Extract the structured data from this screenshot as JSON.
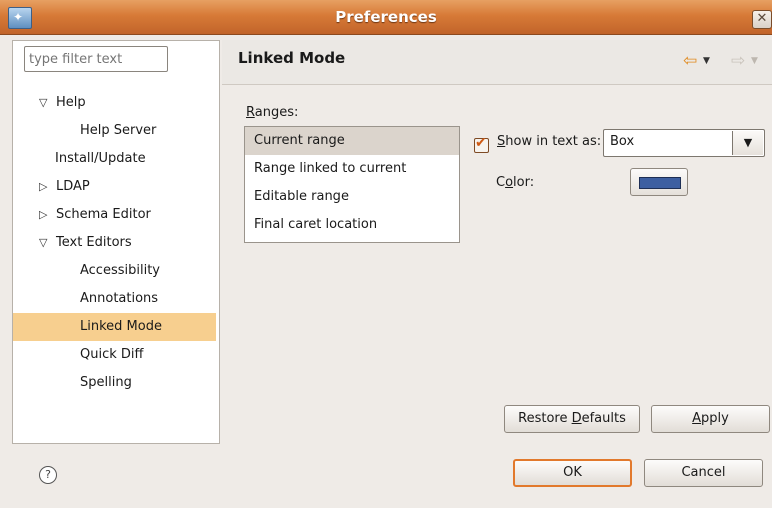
{
  "window": {
    "title": "Preferences",
    "close_glyph": "✕"
  },
  "filter": {
    "placeholder": "type filter text"
  },
  "tree": {
    "items": [
      {
        "label": "Help",
        "twisty": "▽",
        "indent": 0
      },
      {
        "label": "Help Server",
        "indent": 2
      },
      {
        "label": "Install/Update",
        "indent": 1
      },
      {
        "label": "LDAP",
        "twisty": "▷",
        "indent": 0
      },
      {
        "label": "Schema Editor",
        "twisty": "▷",
        "indent": 0
      },
      {
        "label": "Text Editors",
        "twisty": "▽",
        "indent": 0
      },
      {
        "label": "Accessibility",
        "indent": 2
      },
      {
        "label": "Annotations",
        "indent": 2
      },
      {
        "label": "Linked Mode",
        "indent": 2,
        "selected": true
      },
      {
        "label": "Quick Diff",
        "indent": 2
      },
      {
        "label": "Spelling",
        "indent": 2
      }
    ]
  },
  "page": {
    "title": "Linked Mode",
    "back_icon": "⇦",
    "forward_icon": "⇨",
    "caret": "▼"
  },
  "ranges": {
    "label_mnemonic": "R",
    "label_rest": "anges:",
    "items": [
      "Current range",
      "Range linked to current",
      "Editable range",
      "Final caret location"
    ],
    "selected_index": 0
  },
  "options": {
    "show_label_mnemonic": "S",
    "show_label_rest": "how in text as:",
    "show_checked": true,
    "style_value": "Box",
    "dropdown_glyph": "▼",
    "color_label_pre": "C",
    "color_label_mnemonic": "o",
    "color_label_post": "lor:",
    "color_value": "#3d5fa1"
  },
  "buttons": {
    "restore_pre": "Restore ",
    "restore_mnemonic": "D",
    "restore_post": "efaults",
    "apply_mnemonic": "A",
    "apply_rest": "pply",
    "ok": "OK",
    "cancel": "Cancel"
  },
  "footer": {
    "help_glyph": "?"
  }
}
